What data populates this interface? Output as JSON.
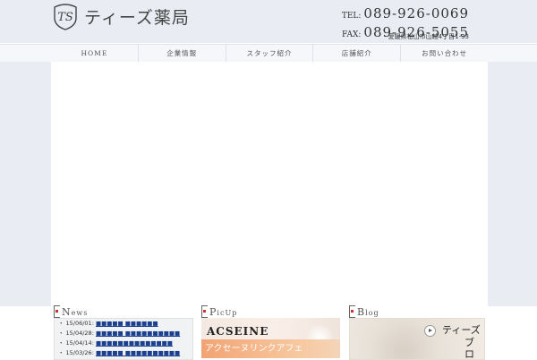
{
  "header": {
    "logo_text": "ティーズ薬局",
    "logo_mark": "TS",
    "tel_label": "TEL:",
    "tel": "089-926-0069",
    "fax_label": "FAX:",
    "fax": "089-926-5055",
    "address": "愛媛県松山市山越4丁目1-33"
  },
  "nav": {
    "items": [
      "HOME",
      "企業情報",
      "スタッフ紹介",
      "店舗紹介",
      "お問い合わせ"
    ]
  },
  "sections": {
    "news_first": "N",
    "news_rest": "ews",
    "pickup_first": "P",
    "pickup_rest": "icUp",
    "blog_first": "B",
    "blog_rest": "log"
  },
  "news": [
    {
      "date": "15/06/01:",
      "title": "■■■■■ ■■■■■■"
    },
    {
      "date": "15/04/28:",
      "title": "■■■■■ ■■■■■■■■■■"
    },
    {
      "date": "15/04/14:",
      "title": "■■■■■■■■■■■■■■"
    },
    {
      "date": "15/03/26:",
      "title": "■■■■■ ■■■■■■■■■■"
    }
  ],
  "pickup": {
    "brand": "ACSEINE",
    "caption": "アクセーヌリンクアフェ"
  },
  "blog": {
    "title_line1": "ティーズ",
    "title_line2": "ブロ"
  },
  "colors": {
    "header_bg": "#e9edf3",
    "link": "#1a3f8f",
    "accent_dot": "#cc3333",
    "pickup_band": "#f2a373"
  }
}
